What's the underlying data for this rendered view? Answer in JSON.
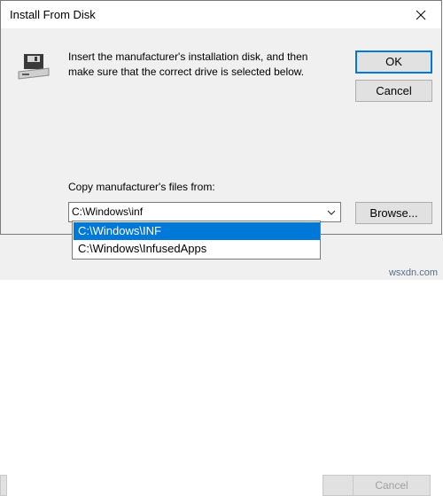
{
  "dialog": {
    "title": "Install From Disk",
    "instruction": "Insert the manufacturer's installation disk, and then make sure that the correct drive is selected below.",
    "ok_label": "OK",
    "cancel_label": "Cancel",
    "copy_label": "Copy manufacturer's files from:",
    "path_value": "C:\\Windows\\inf",
    "browse_label": "Browse..."
  },
  "dropdown": {
    "items": [
      "C:\\Windows\\INF",
      "C:\\Windows\\InfusedApps"
    ]
  },
  "background_window": {
    "cancel_label": "Cancel"
  },
  "watermark": "wsxdn.com",
  "colors": {
    "accent": "#0078d7",
    "dialog_bg": "#f0f0f0"
  }
}
